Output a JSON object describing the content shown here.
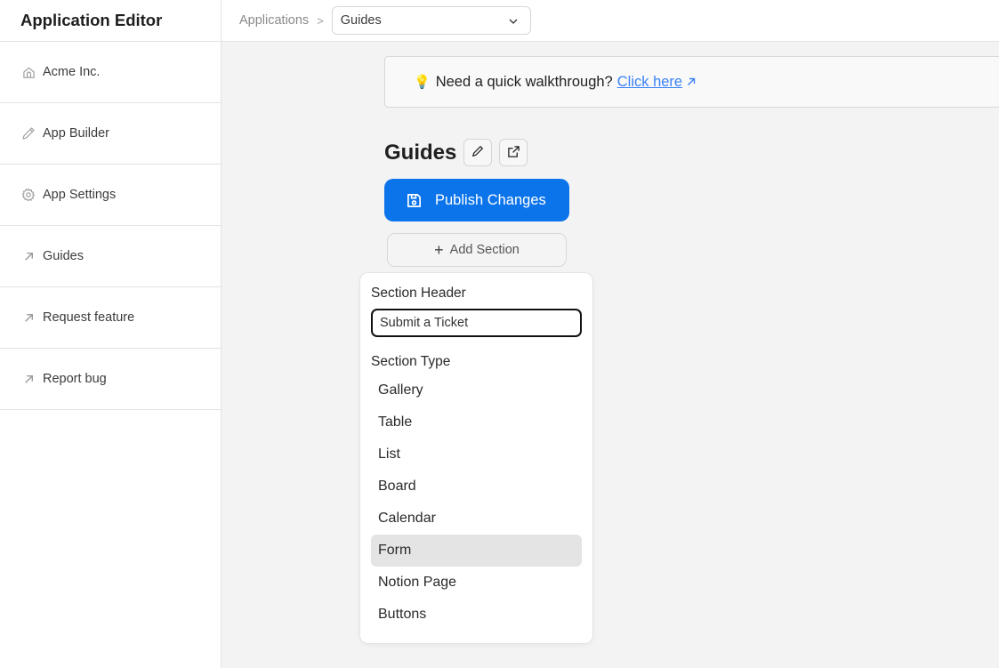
{
  "sidebar": {
    "title": "Application Editor",
    "items": [
      {
        "label": "Acme Inc.",
        "icon": "home-icon"
      },
      {
        "label": "App Builder",
        "icon": "pencil-icon"
      },
      {
        "label": "App Settings",
        "icon": "gear-icon"
      },
      {
        "label": "Guides",
        "icon": "external-arrow-icon"
      },
      {
        "label": "Request feature",
        "icon": "external-arrow-icon"
      },
      {
        "label": "Report bug",
        "icon": "external-arrow-icon"
      }
    ]
  },
  "topbar": {
    "breadcrumb_root": "Applications",
    "breadcrumb_separator": ">",
    "app_select_value": "Guides"
  },
  "banner": {
    "emoji": "💡",
    "text": "Need a quick walkthrough?",
    "link_label": "Click here"
  },
  "page": {
    "title": "Guides",
    "publish_label": "Publish Changes",
    "add_section_label": "Add Section"
  },
  "section_popover": {
    "header_label": "Section Header",
    "header_value": "Submit a Ticket",
    "type_label": "Section Type",
    "types": [
      "Gallery",
      "Table",
      "List",
      "Board",
      "Calendar",
      "Form",
      "Notion Page",
      "Buttons"
    ],
    "selected_type": "Form"
  },
  "colors": {
    "primary": "#0b74ea",
    "link": "#3b82f6",
    "selected_bg": "#e4e4e4",
    "canvas_bg": "#f3f3f3"
  }
}
